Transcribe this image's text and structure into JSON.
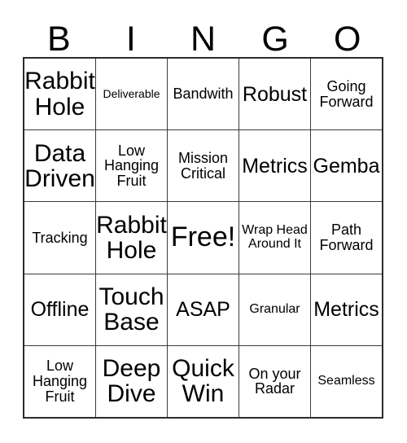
{
  "card": {
    "title_letters": [
      "B",
      "I",
      "N",
      "G",
      "O"
    ],
    "free_space_label": "Free!",
    "rows": [
      [
        {
          "text": "Rabbit Hole",
          "size": "xxl"
        },
        {
          "text": "Deliverable",
          "size": "xs"
        },
        {
          "text": "Bandwith",
          "size": "md"
        },
        {
          "text": "Robust",
          "size": "xl"
        },
        {
          "text": "Going Forward",
          "size": "md"
        }
      ],
      [
        {
          "text": "Data Driven",
          "size": "xxl"
        },
        {
          "text": "Low Hanging Fruit",
          "size": "md"
        },
        {
          "text": "Mission Critical",
          "size": "md"
        },
        {
          "text": "Metrics",
          "size": "xl"
        },
        {
          "text": "Gemba",
          "size": "xl"
        }
      ],
      [
        {
          "text": "Tracking",
          "size": "md"
        },
        {
          "text": "Rabbit Hole",
          "size": "xxl"
        },
        {
          "text": "Free!",
          "size": "free"
        },
        {
          "text": "Wrap Head Around It",
          "size": "sm"
        },
        {
          "text": "Path Forward",
          "size": "md"
        }
      ],
      [
        {
          "text": "Offline",
          "size": "xl"
        },
        {
          "text": "Touch Base",
          "size": "xxl"
        },
        {
          "text": "ASAP",
          "size": "xl"
        },
        {
          "text": "Granular",
          "size": "sm"
        },
        {
          "text": "Metrics",
          "size": "xl"
        }
      ],
      [
        {
          "text": "Low Hanging Fruit",
          "size": "md"
        },
        {
          "text": "Deep Dive",
          "size": "xxl"
        },
        {
          "text": "Quick Win",
          "size": "xxl"
        },
        {
          "text": "On your Radar",
          "size": "md"
        },
        {
          "text": "Seamless",
          "size": "sm"
        }
      ]
    ]
  },
  "colors": {
    "background": "#ffffff",
    "text": "#000000",
    "outer_border": "#2b2b2b",
    "inner_border": "#3a3a3a"
  }
}
